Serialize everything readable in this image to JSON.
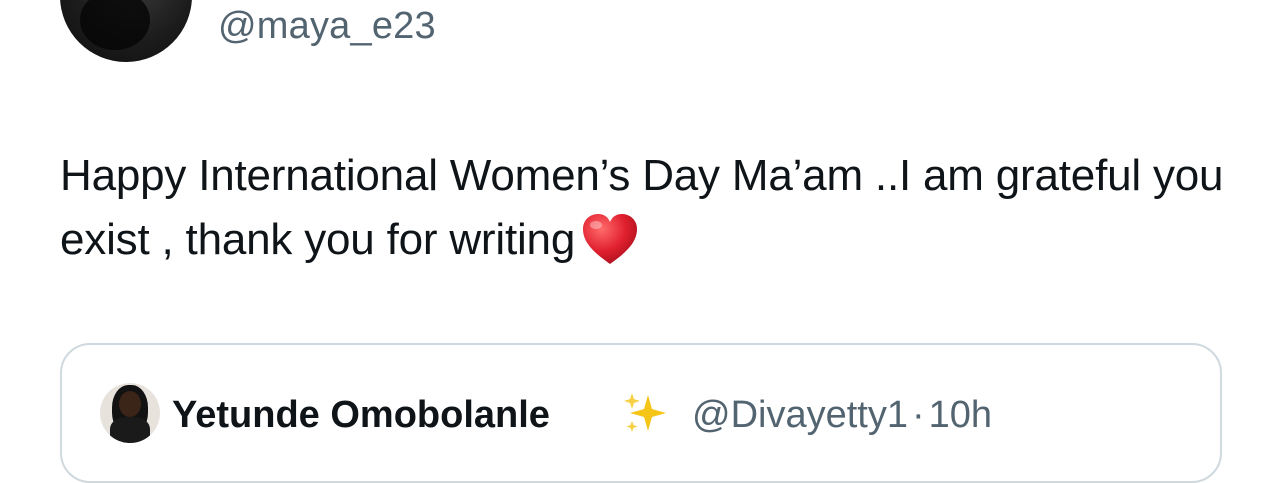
{
  "tweet": {
    "author_handle": "@maya_e23",
    "text": "Happy International Women’s Day Ma’am ..I am grateful you exist , thank you for writing",
    "emoji": "heart-emoji"
  },
  "quoted_tweet": {
    "author_name": "Yetunde Omobolanle",
    "name_emoji": "sparkles-emoji",
    "author_handle": "@Divayetty1",
    "separator": "·",
    "time_ago": "10h"
  },
  "colors": {
    "text_primary": "#0f1419",
    "text_secondary": "#536471",
    "border": "#cfd9de",
    "heart": "#e0202e",
    "sparkle": "#f5c518"
  }
}
